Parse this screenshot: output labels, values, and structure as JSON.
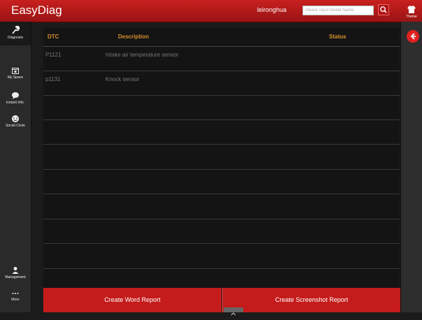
{
  "app": {
    "title": "EasyDiag",
    "user": "leironghua",
    "search_placeholder": "Please Input Model Name",
    "theme_label": "Theme"
  },
  "sidebar": {
    "items": [
      {
        "label": "Diagnosis",
        "icon": "wrench-icon",
        "active": true
      },
      {
        "label": "My Space",
        "icon": "calendar-icon"
      },
      {
        "label": "Instant Info.",
        "icon": "chat-bubble-icon"
      },
      {
        "label": "Social Circle",
        "icon": "smiley-icon"
      },
      {
        "label": "Management",
        "icon": "person-icon"
      },
      {
        "label": "More",
        "icon": "more-icon"
      }
    ]
  },
  "table": {
    "headers": {
      "dtc": "DTC",
      "description": "Description",
      "status": "Status"
    },
    "rows": [
      {
        "dtc": "P1121",
        "description": "Intake air temperature sensor",
        "status": ""
      },
      {
        "dtc": "p1131",
        "description": "Knock sensor",
        "status": ""
      }
    ]
  },
  "footer": {
    "word_report": "Create Word Report",
    "screenshot_report": "Create Screenshot Report"
  },
  "colors": {
    "primary": "#c41b1b",
    "header_text": "#d8902c",
    "background": "#141414"
  }
}
